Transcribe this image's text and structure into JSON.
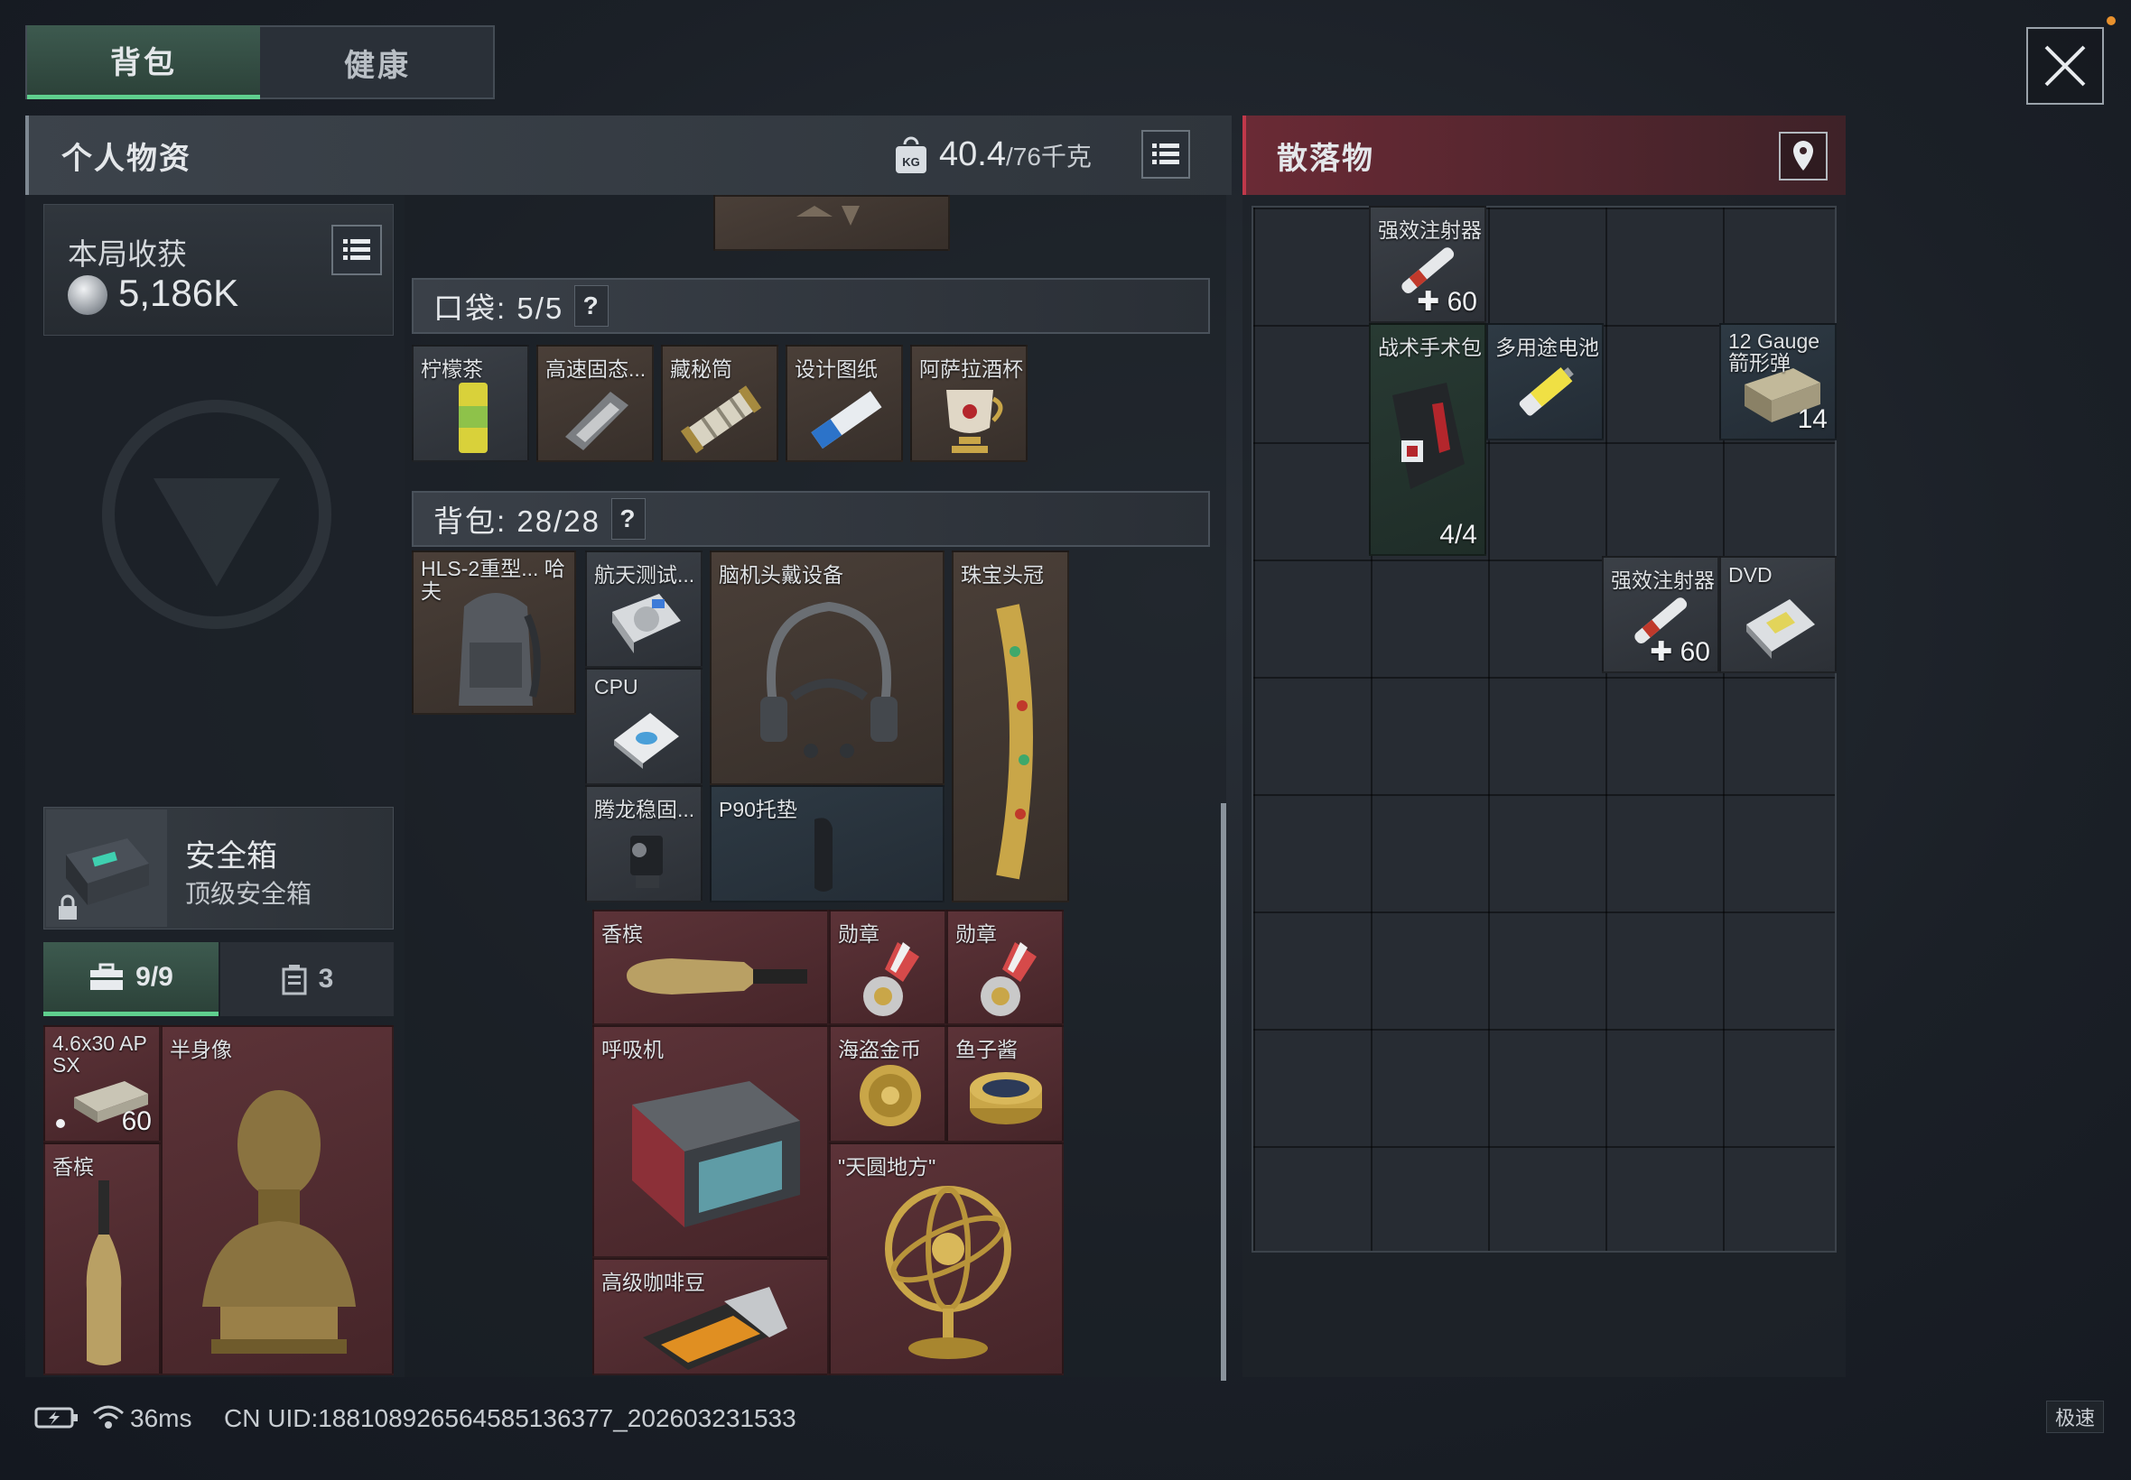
{
  "tabs": [
    {
      "label": "背包",
      "active": true
    },
    {
      "label": "健康",
      "active": false
    }
  ],
  "personal": {
    "title": "个人物资",
    "weight_current": "40.4",
    "weight_max": "/76千克",
    "weight_badge": "KG"
  },
  "harvest": {
    "label": "本局收获",
    "value": "5,186K"
  },
  "pocket": {
    "label": "口袋: 5/5",
    "help": "?",
    "items": [
      "柠檬茶",
      "高速固态...",
      "藏秘筒",
      "设计图纸",
      "阿萨拉酒杯"
    ]
  },
  "backpack": {
    "label": "背包: 28/28",
    "help": "?",
    "items": {
      "bag": "HLS-2重型... 哈夫",
      "aero": "航天测试...",
      "headset": "脑机头戴设备",
      "crown": "珠宝头冠",
      "cpu": "CPU",
      "tenglong": "腾龙稳固...",
      "p90": "P90托垫",
      "champagne": "香槟",
      "medal1": "勋章",
      "medal2": "勋章",
      "respirator": "呼吸机",
      "coin": "海盗金币",
      "caviar": "鱼子酱",
      "globe": "\"天圆地方\"",
      "coffee": "高级咖啡豆"
    }
  },
  "safebox": {
    "title": "安全箱",
    "subtitle": "顶级安全箱",
    "tab_count": "9/9",
    "tab_other": "3",
    "items": {
      "ammo": "4.6x30 AP SX",
      "ammo_count": "60",
      "bust": "半身像",
      "champagne": "香槟"
    }
  },
  "loot": {
    "title": "散落物",
    "items": {
      "injector1": "强效注射器",
      "injector1_count": "60",
      "medkit": "战术手术包",
      "medkit_count": "4/4",
      "battery": "多用途电池",
      "gauge": "12 Gauge 箭形弹",
      "gauge_count": "14",
      "injector2": "强效注射器",
      "injector2_count": "60",
      "dvd": "DVD"
    }
  },
  "status": {
    "ping": "36ms",
    "uid": "CN UID:188108926564585136377_202603231533",
    "mode": "极速"
  },
  "colors": {
    "accent_green": "#5fcf8e",
    "loot_red": "#c0384a"
  }
}
